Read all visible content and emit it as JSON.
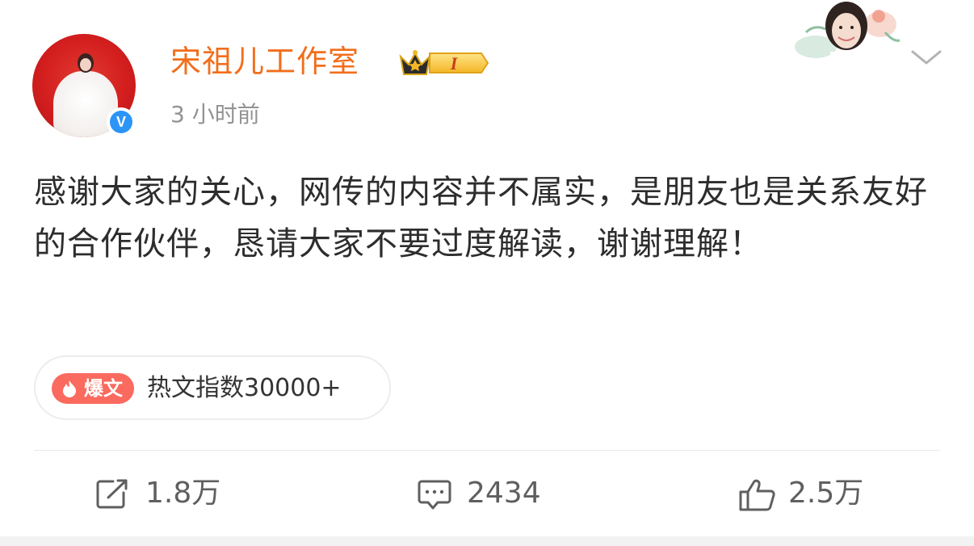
{
  "post": {
    "author": {
      "name": "宋祖儿工作室",
      "rank_badge_text": "I",
      "verified_mark": "V",
      "avatar_icon": "avatar-photo",
      "verified_icon": "verified-v-icon"
    },
    "timestamp": "3 小时前",
    "text": "感谢大家的关心，网传的内容并不属实，是朋友也是关系友好的合作伙伴，恳请大家不要过度解读，谢谢理解！",
    "hot": {
      "tag_label": "爆文",
      "index_text": "热文指数30000+",
      "tag_color": "#fa6a5e"
    },
    "actions": {
      "repost_count": "1.8万",
      "comment_count": "2434",
      "like_count": "2.5万"
    }
  },
  "colors": {
    "username": "#f26e1c",
    "timestamp": "#939393",
    "verified": "#2b94f7",
    "action_text": "#5f5f5f"
  }
}
